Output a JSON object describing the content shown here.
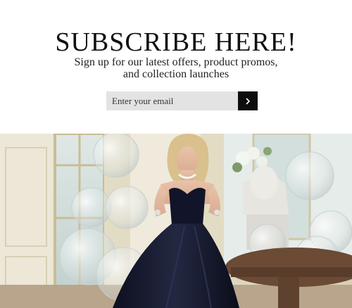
{
  "signup": {
    "title": "SUBSCRIBE HERE!",
    "subtitle_line1": "Sign up for our latest offers, product promos,",
    "subtitle_line2": "and collection launches",
    "email_placeholder": "Enter your email",
    "submit_icon": "chevron-right-icon"
  },
  "hero": {
    "image": "model-in-black-ball-gown",
    "colors": {
      "dress": "#14172a",
      "wall": "#e8e2cf",
      "table": "#6b4a36"
    }
  }
}
